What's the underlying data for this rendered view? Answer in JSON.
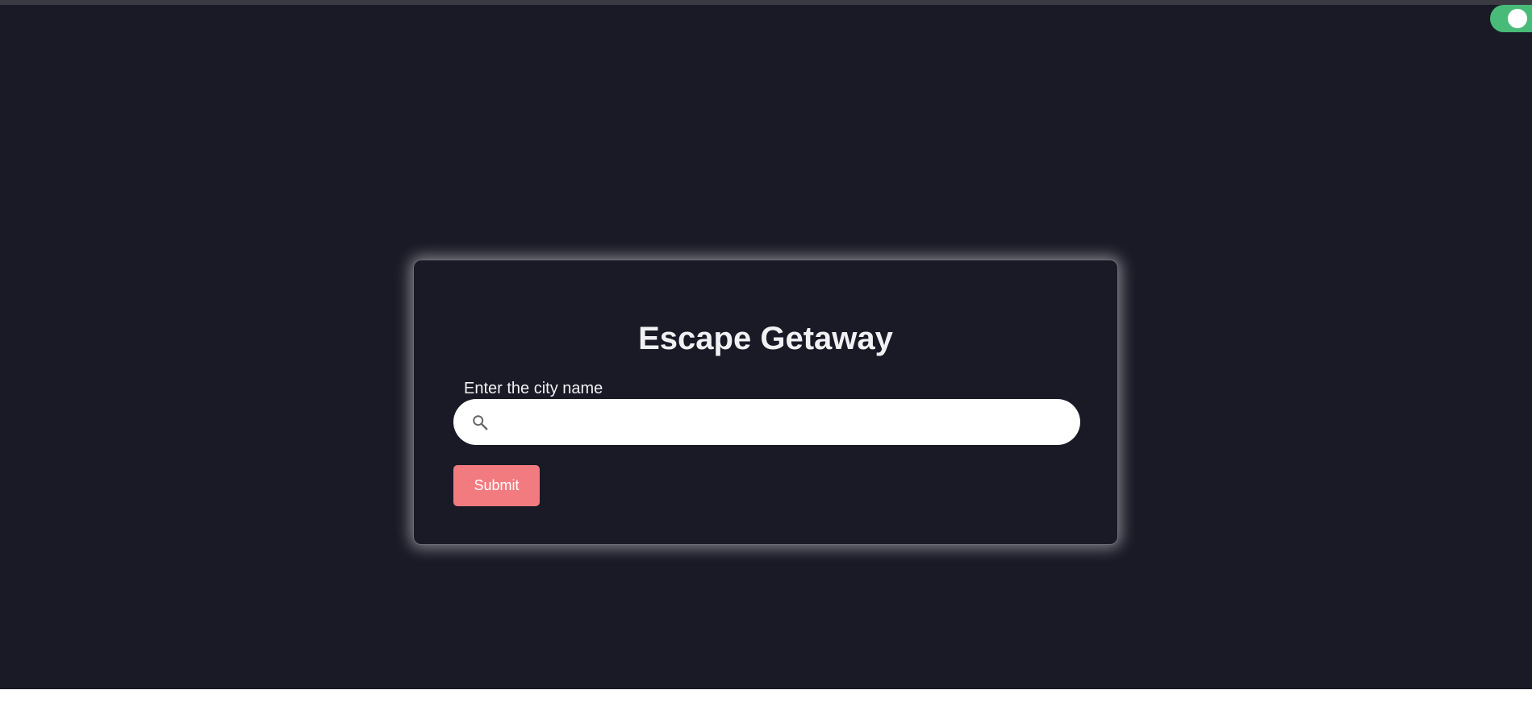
{
  "app": {
    "title": "Escape Getaway"
  },
  "form": {
    "city_label": "Enter the city name",
    "search": {
      "value": "",
      "placeholder": "",
      "icon": "search-icon"
    },
    "submit_label": "Submit"
  },
  "theme_toggle": {
    "state": "on",
    "icon": "toggle-switch"
  },
  "colors": {
    "page_background": "#1a1a27",
    "toggle_on": "#48bb78",
    "submit_button": "#f27b7f",
    "title_text": "#f1f1f4"
  }
}
